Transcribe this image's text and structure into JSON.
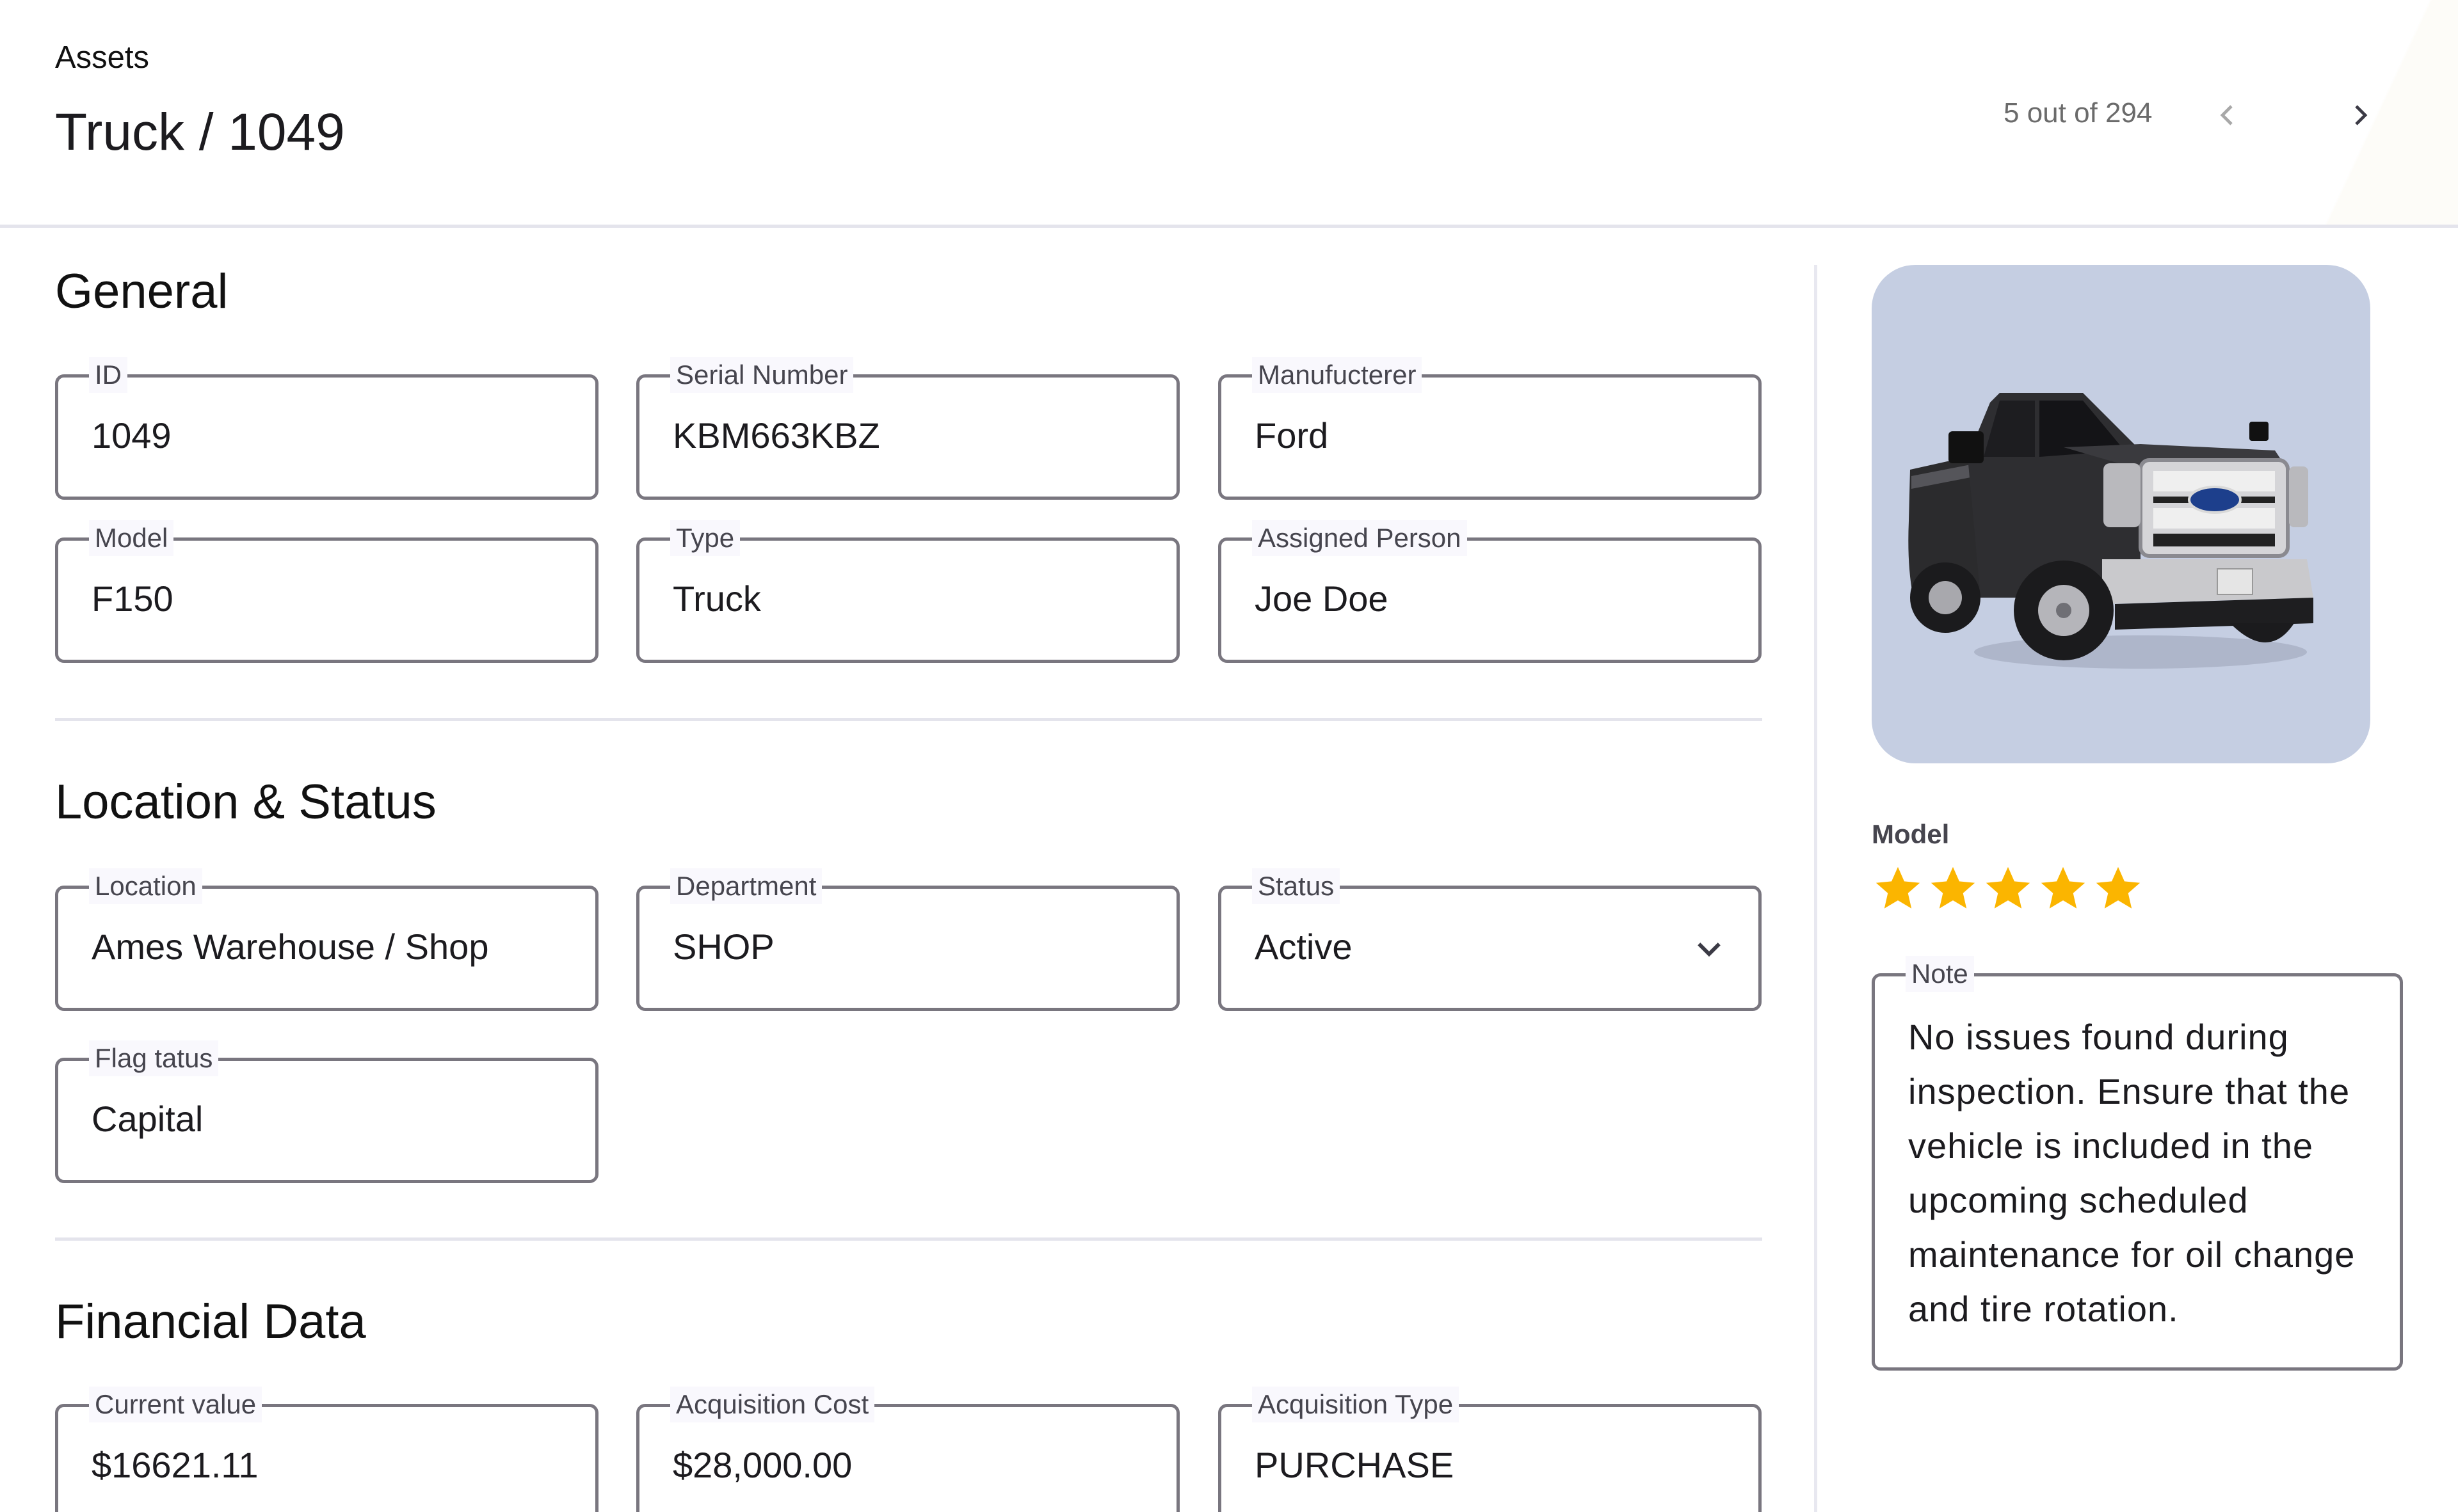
{
  "header": {
    "breadcrumb": "Assets",
    "title": "Truck / 1049",
    "pager": {
      "text": "5 out of 294",
      "current": 5,
      "total": 294,
      "prev_icon": "chevron-left-icon",
      "next_icon": "chevron-right-icon"
    }
  },
  "sections": {
    "general": {
      "title": "General",
      "fields": [
        {
          "label": "ID",
          "value": "1049"
        },
        {
          "label": "Serial Number",
          "value": "KBM663KBZ"
        },
        {
          "label": "Manufucterer",
          "value": "Ford"
        },
        {
          "label": "Model",
          "value": "F150"
        },
        {
          "label": "Type",
          "value": "Truck"
        },
        {
          "label": "Assigned Person",
          "value": "Joe Doe"
        }
      ]
    },
    "location": {
      "title": "Location & Status",
      "fields": [
        {
          "label": "Location",
          "value": "Ames Warehouse / Shop"
        },
        {
          "label": "Department",
          "value": "SHOP"
        },
        {
          "label": "Status",
          "value": "Active",
          "icon": "chevron-down-icon"
        },
        {
          "label": "Flag tatus",
          "value": "Capital"
        }
      ]
    },
    "financial": {
      "title": "Financial Data",
      "fields": [
        {
          "label": "Current value",
          "value": "$16621.11"
        },
        {
          "label": "Acquisition Cost",
          "value": "$28,000.00"
        },
        {
          "label": "Acquisition Type",
          "value": "PURCHASE"
        }
      ]
    }
  },
  "sidebar": {
    "image_alt": "Ford pickup truck photo",
    "image_bg": "#c5cee2",
    "rating": {
      "label": "Model",
      "value": 5,
      "max": 5,
      "color": "#fbb500"
    },
    "note": {
      "label": "Note",
      "text": "No issues found during inspection. Ensure that the vehicle is included in the upcoming scheduled maintenance for oil change and tire rotation."
    }
  }
}
